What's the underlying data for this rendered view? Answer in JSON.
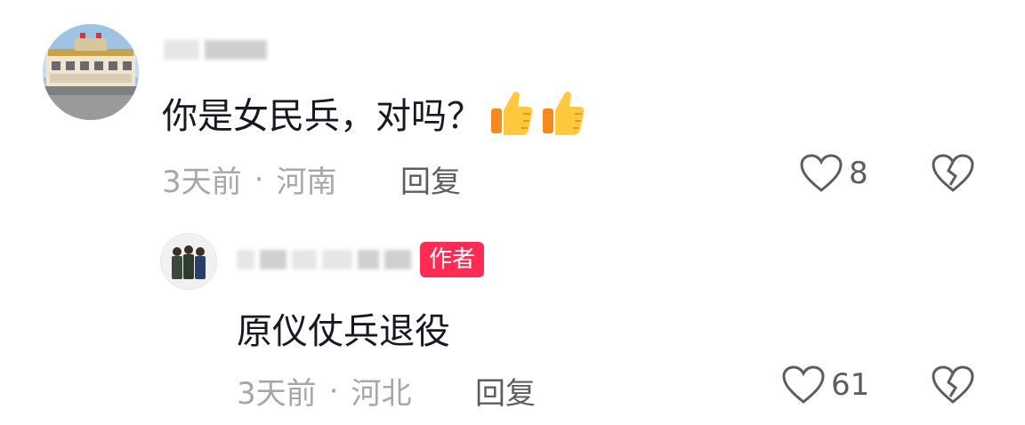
{
  "comments": [
    {
      "text": "你是女民兵，对吗？",
      "time": "3天前",
      "location": "河南",
      "reply_label": "回复",
      "like_count": "8",
      "emoji": "thumbs-up-icon"
    }
  ],
  "reply": {
    "badge": "作者",
    "text": "原仪仗兵退役",
    "time": "3天前",
    "location": "河北",
    "reply_label": "回复",
    "like_count": "61"
  },
  "separator": "·",
  "colors": {
    "badge_bg": "#fe2c55",
    "text": "#161823",
    "meta": "#a6a7ab",
    "action": "#5c5d63"
  }
}
